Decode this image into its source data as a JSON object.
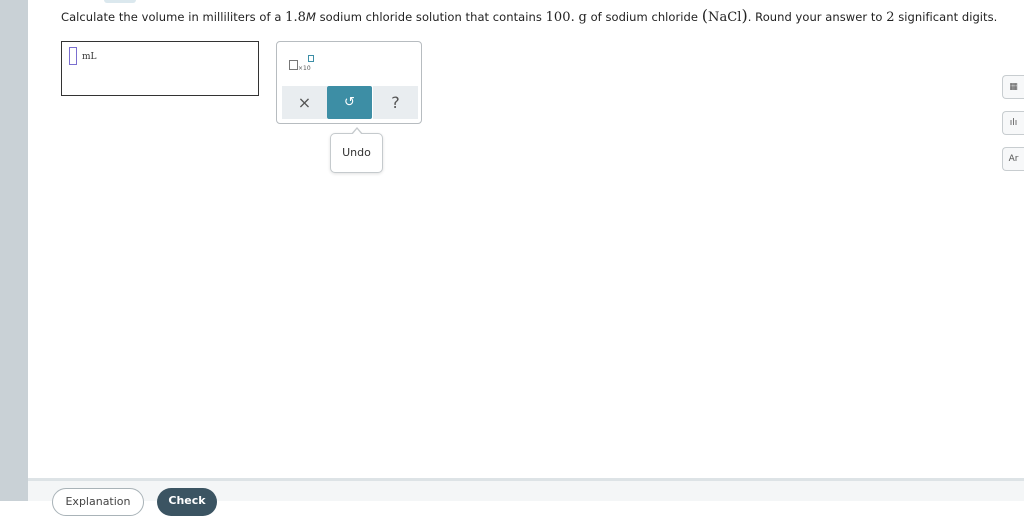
{
  "question": {
    "part1": "Calculate the volume in milliliters of a ",
    "concentration_value": "1.8",
    "concentration_unit": "M",
    "part2": " sodium chloride solution that contains ",
    "mass": "100.",
    "mass_unit": "g",
    "part3": " of sodium chloride ",
    "formula": "NaCl",
    "part4": ". Round your answer to ",
    "sig_figs": "2",
    "part5": " significant digits."
  },
  "answer": {
    "value": "",
    "unit": "mL"
  },
  "tools": {
    "sci_notation_label": "×10",
    "clear_symbol": "×",
    "undo_symbol": "↺",
    "help_symbol": "?",
    "accent_color": "#3d8ea5"
  },
  "tooltip": {
    "text": "Undo"
  },
  "side_tools": [
    {
      "name": "calculator-icon",
      "glyph": "▦"
    },
    {
      "name": "chart-icon",
      "glyph": "ılı"
    },
    {
      "name": "periodic-table-icon",
      "glyph": "Ar"
    }
  ],
  "footer": {
    "explanation_label": "Explanation",
    "check_label": "Check"
  }
}
